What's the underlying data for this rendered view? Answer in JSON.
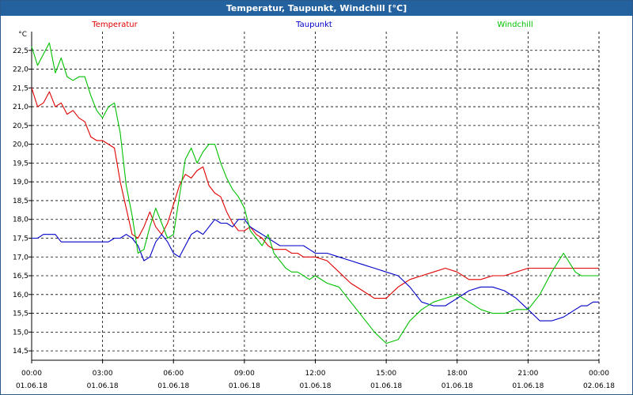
{
  "window": {
    "title": "Temperatur, Taupunkt, Windchill [°C]"
  },
  "colors": {
    "titlebar": "#23629f",
    "temperatur": "#e00000",
    "taupunkt": "#0000c8",
    "windchill": "#00c000",
    "grid": "#000000"
  },
  "chart_data": {
    "type": "line",
    "title": "Temperatur, Taupunkt, Windchill [°C]",
    "ylabel": "°C",
    "ylim": [
      14.25,
      23.0
    ],
    "xlim_hours": [
      0,
      24
    ],
    "yticks": [
      "14,5",
      "15,0",
      "15,5",
      "16,0",
      "16,5",
      "17,0",
      "17,5",
      "18,0",
      "18,5",
      "19,0",
      "19,5",
      "20,0",
      "20,5",
      "21,0",
      "21,5",
      "22,0",
      "22,5"
    ],
    "yticks_values": [
      14.5,
      15.0,
      15.5,
      16.0,
      16.5,
      17.0,
      17.5,
      18.0,
      18.5,
      19.0,
      19.5,
      20.0,
      20.5,
      21.0,
      21.5,
      22.0,
      22.5
    ],
    "xticks": [
      {
        "time": "00:00",
        "date": "01.06.18"
      },
      {
        "time": "03:00",
        "date": "01.06.18"
      },
      {
        "time": "06:00",
        "date": "01.06.18"
      },
      {
        "time": "09:00",
        "date": "01.06.18"
      },
      {
        "time": "12:00",
        "date": "01.06.18"
      },
      {
        "time": "15:00",
        "date": "01.06.18"
      },
      {
        "time": "18:00",
        "date": "01.06.18"
      },
      {
        "time": "21:00",
        "date": "01.06.18"
      },
      {
        "time": "00:00",
        "date": "02.06.18"
      }
    ],
    "grid": true,
    "series": [
      {
        "name": "Temperatur",
        "color": "#e00000",
        "x": [
          0,
          0.25,
          0.5,
          0.75,
          1.0,
          1.25,
          1.5,
          1.75,
          2.0,
          2.25,
          2.5,
          2.75,
          3.0,
          3.25,
          3.5,
          3.75,
          4.0,
          4.25,
          4.5,
          4.75,
          5.0,
          5.25,
          5.5,
          5.75,
          6.0,
          6.25,
          6.5,
          6.75,
          7.0,
          7.25,
          7.5,
          7.75,
          8.0,
          8.25,
          8.5,
          8.75,
          9.0,
          9.25,
          9.5,
          9.75,
          10.0,
          10.25,
          10.5,
          10.75,
          11.0,
          11.25,
          11.5,
          11.75,
          12.0,
          12.5,
          13.0,
          13.5,
          14.0,
          14.5,
          15.0,
          15.5,
          16.0,
          16.5,
          17.0,
          17.5,
          18.0,
          18.5,
          19.0,
          19.5,
          20.0,
          20.5,
          21.0,
          21.5,
          22.0,
          22.5,
          23.0,
          23.25,
          23.5,
          23.75,
          24.0
        ],
        "y": [
          21.5,
          21.0,
          21.1,
          21.4,
          21.0,
          21.1,
          20.8,
          20.9,
          20.7,
          20.6,
          20.2,
          20.1,
          20.1,
          20.0,
          19.9,
          19.0,
          18.3,
          17.6,
          17.5,
          17.8,
          18.2,
          17.8,
          17.6,
          17.9,
          18.4,
          18.9,
          19.2,
          19.1,
          19.3,
          19.4,
          18.9,
          18.7,
          18.6,
          18.2,
          17.9,
          17.7,
          17.7,
          17.8,
          17.6,
          17.5,
          17.3,
          17.2,
          17.2,
          17.2,
          17.1,
          17.1,
          17.0,
          17.0,
          17.0,
          16.9,
          16.6,
          16.3,
          16.1,
          15.9,
          15.9,
          16.2,
          16.4,
          16.5,
          16.6,
          16.7,
          16.6,
          16.4,
          16.4,
          16.5,
          16.5,
          16.6,
          16.7,
          16.7,
          16.7,
          16.7,
          16.7,
          16.7,
          16.7,
          16.7,
          16.7
        ]
      },
      {
        "name": "Taupunkt",
        "color": "#0000c8",
        "x": [
          0,
          0.25,
          0.5,
          0.75,
          1.0,
          1.25,
          1.5,
          1.75,
          2.0,
          2.25,
          2.5,
          2.75,
          3.0,
          3.25,
          3.5,
          3.75,
          4.0,
          4.25,
          4.5,
          4.75,
          5.0,
          5.25,
          5.5,
          5.75,
          6.0,
          6.25,
          6.5,
          6.75,
          7.0,
          7.25,
          7.5,
          7.75,
          8.0,
          8.25,
          8.5,
          8.75,
          9.0,
          9.25,
          9.5,
          9.75,
          10.0,
          10.25,
          10.5,
          10.75,
          11.0,
          11.25,
          11.5,
          11.75,
          12.0,
          12.5,
          13.0,
          13.5,
          14.0,
          14.5,
          15.0,
          15.5,
          16.0,
          16.5,
          17.0,
          17.5,
          18.0,
          18.5,
          19.0,
          19.5,
          20.0,
          20.5,
          21.0,
          21.5,
          22.0,
          22.5,
          23.0,
          23.25,
          23.5,
          23.75,
          24.0
        ],
        "y": [
          17.5,
          17.5,
          17.6,
          17.6,
          17.6,
          17.4,
          17.4,
          17.4,
          17.4,
          17.4,
          17.4,
          17.4,
          17.4,
          17.4,
          17.5,
          17.5,
          17.6,
          17.5,
          17.3,
          16.9,
          17.0,
          17.4,
          17.6,
          17.4,
          17.1,
          17.0,
          17.3,
          17.6,
          17.7,
          17.6,
          17.8,
          18.0,
          17.9,
          17.9,
          17.8,
          18.0,
          18.0,
          17.8,
          17.7,
          17.6,
          17.5,
          17.4,
          17.3,
          17.3,
          17.3,
          17.3,
          17.3,
          17.2,
          17.1,
          17.1,
          17.0,
          16.9,
          16.8,
          16.7,
          16.6,
          16.5,
          16.2,
          15.8,
          15.7,
          15.7,
          15.9,
          16.1,
          16.2,
          16.2,
          16.1,
          15.9,
          15.6,
          15.3,
          15.3,
          15.4,
          15.6,
          15.7,
          15.7,
          15.8,
          15.8
        ]
      },
      {
        "name": "Windchill",
        "color": "#00c000",
        "x": [
          0,
          0.25,
          0.5,
          0.75,
          1.0,
          1.25,
          1.5,
          1.75,
          2.0,
          2.25,
          2.5,
          2.75,
          3.0,
          3.25,
          3.5,
          3.75,
          4.0,
          4.25,
          4.5,
          4.75,
          5.0,
          5.25,
          5.5,
          5.75,
          6.0,
          6.25,
          6.5,
          6.75,
          7.0,
          7.25,
          7.5,
          7.75,
          8.0,
          8.25,
          8.5,
          8.75,
          9.0,
          9.25,
          9.5,
          9.75,
          10.0,
          10.25,
          10.5,
          10.75,
          11.0,
          11.25,
          11.5,
          11.75,
          12.0,
          12.5,
          13.0,
          13.5,
          14.0,
          14.5,
          15.0,
          15.5,
          16.0,
          16.5,
          17.0,
          17.5,
          18.0,
          18.5,
          19.0,
          19.5,
          20.0,
          20.5,
          21.0,
          21.5,
          22.0,
          22.5,
          23.0,
          23.25,
          23.5,
          23.75,
          24.0
        ],
        "y": [
          22.6,
          22.1,
          22.4,
          22.7,
          21.9,
          22.3,
          21.8,
          21.7,
          21.8,
          21.8,
          21.3,
          20.9,
          20.7,
          21.0,
          21.1,
          20.3,
          18.9,
          18.1,
          17.1,
          17.2,
          17.8,
          18.3,
          17.9,
          17.5,
          17.6,
          18.6,
          19.6,
          19.9,
          19.5,
          19.8,
          20.0,
          20.0,
          19.5,
          19.1,
          18.8,
          18.6,
          18.3,
          17.7,
          17.5,
          17.3,
          17.6,
          17.1,
          16.9,
          16.7,
          16.6,
          16.6,
          16.5,
          16.4,
          16.5,
          16.3,
          16.2,
          15.8,
          15.4,
          15.0,
          14.7,
          14.8,
          15.3,
          15.6,
          15.8,
          15.9,
          16.0,
          15.8,
          15.6,
          15.5,
          15.5,
          15.6,
          15.6,
          16.0,
          16.6,
          17.1,
          16.6,
          16.5,
          16.5,
          16.5,
          16.5
        ]
      }
    ]
  }
}
